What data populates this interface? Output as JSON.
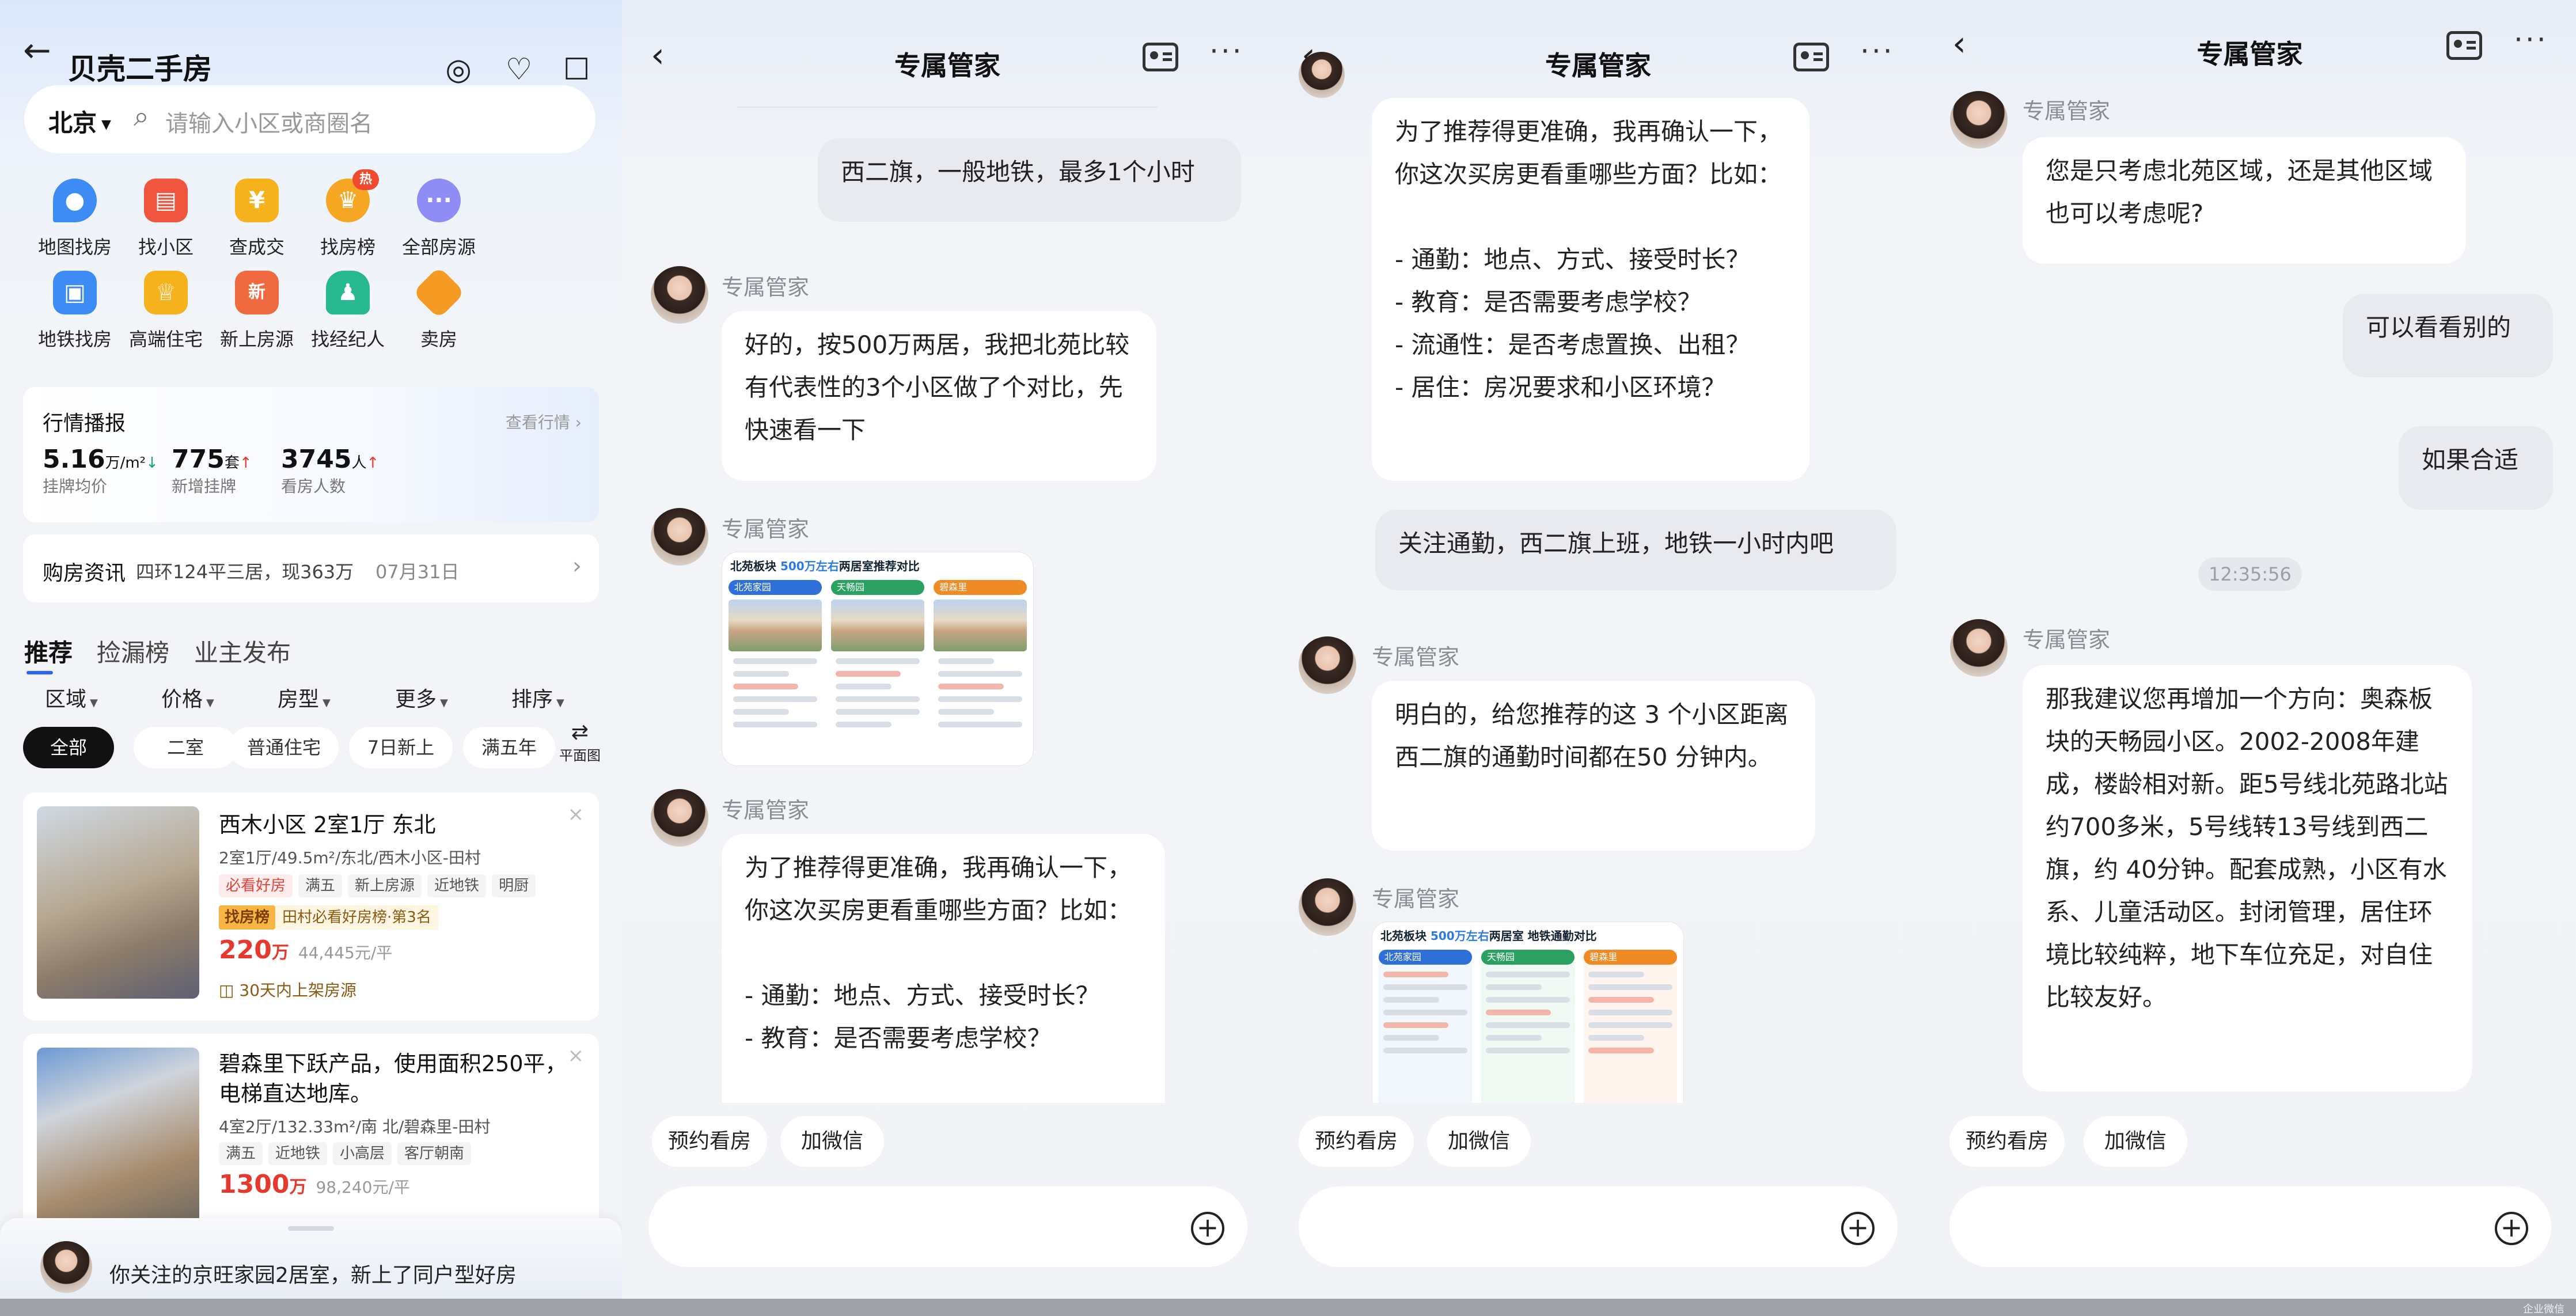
{
  "home": {
    "title": "贝壳二手房",
    "search": {
      "city": "北京",
      "placeholder": "请输入小区或商圈名"
    },
    "grid": [
      {
        "label": "地图找房",
        "icon": "map-pin-icon",
        "color": "#3d8bf5"
      },
      {
        "label": "找小区",
        "icon": "building-icon",
        "color": "#f0563f"
      },
      {
        "label": "查成交",
        "icon": "yen-icon",
        "color": "#f5b21c"
      },
      {
        "label": "找房榜",
        "icon": "crown-icon",
        "color": "#f5a623",
        "badge": "热"
      },
      {
        "label": "全部房源",
        "icon": "dots-icon",
        "color": "#8f8cf5"
      },
      {
        "label": "地铁找房",
        "icon": "subway-icon",
        "color": "#3d8bf5"
      },
      {
        "label": "高端住宅",
        "icon": "crown-icon",
        "color": "#f5b21c"
      },
      {
        "label": "新上房源",
        "icon": "new-icon",
        "color": "#f06a3f"
      },
      {
        "label": "找经纪人",
        "icon": "agent-icon",
        "color": "#28b990"
      },
      {
        "label": "卖房",
        "icon": "tag-icon",
        "color": "#f59a23"
      }
    ],
    "market": {
      "title": "行情播报",
      "link": "查看行情",
      "stats": [
        {
          "value": "5.16",
          "unit": "万/m²",
          "label": "挂牌均价",
          "trend": "down"
        },
        {
          "value": "775",
          "unit": "套",
          "label": "新增挂牌",
          "trend": "up"
        },
        {
          "value": "3745",
          "unit": "人",
          "label": "看房人数",
          "trend": "up"
        }
      ]
    },
    "news": {
      "title": "购房资讯",
      "text": "四环124平三居，现363万",
      "date": "07月31日"
    },
    "tabs": [
      "推荐",
      "捡漏榜",
      "业主发布"
    ],
    "filters": [
      "区域",
      "价格",
      "房型",
      "更多",
      "排序"
    ],
    "chips": [
      "全部",
      "二室",
      "普通住宅",
      "7日新上",
      "满五年"
    ],
    "plan_label": "平面图",
    "listings": [
      {
        "title": "西木小区 2室1厅 东北",
        "info": "2室1厅/49.5m²/东北/西木小区-田村",
        "tags": [
          "必看好房",
          "满五",
          "新上房源",
          "近地铁",
          "明厨"
        ],
        "rank_badge": "找房榜",
        "rank_text": "田村必看好房榜·第3名",
        "price": "220",
        "price_unit": "万",
        "unit_price": "44,445元/平",
        "note": "30天内上架房源"
      },
      {
        "title": "碧森里下跃产品，使用面积250平，电梯直达地库。",
        "info": "4室2厅/132.33m²/南 北/碧森里-田村",
        "tags": [
          "满五",
          "近地铁",
          "小高层",
          "客厅朝南"
        ],
        "price": "1300",
        "price_unit": "万",
        "unit_price": "98,240元/平"
      }
    ],
    "notify": "你关注的京旺家园2居室，新上了同户型好房"
  },
  "chat": {
    "title": "专属管家",
    "sender": "专属管家",
    "quick": [
      "预约看房",
      "加微信"
    ],
    "panel2": {
      "user1": "西二旗，一般地铁，最多1个小时",
      "bot1": "好的，按500万两居，我把北苑比较有代表性的3个小区做了个对比，先快速看一下",
      "img": {
        "title_pre": "北苑板块 ",
        "title_hl": "500万左右",
        "title_post": "两居室推荐对比",
        "cols": [
          {
            "name": "北苑家园",
            "color": "#2f6fd8"
          },
          {
            "name": "天畅园",
            "color": "#2aa160"
          },
          {
            "name": "碧森里",
            "color": "#f08a24"
          }
        ]
      },
      "bot2": "为了推荐得更准确，我再确认一下，你这次买房更看重哪些方面？比如：\n\n- 通勤：地点、方式、接受时长？\n- 教育：是否需要考虑学校？"
    },
    "panel3": {
      "bot1": "为了推荐得更准确，我再确认一下，你这次买房更看重哪些方面？比如：\n\n- 通勤：地点、方式、接受时长？\n- 教育：是否需要考虑学校？\n- 流通性：是否考虑置换、出租？\n- 居住：房况要求和小区环境？",
      "user1": "关注通勤，西二旗上班，地铁一小时内吧",
      "bot2": "明白的，给您推荐的这 3 个小区距离西二旗的通勤时间都在50 分钟内。",
      "img": {
        "title_pre": "北苑板块 ",
        "title_hl": "500万左右",
        "title_post": "两居室 地铁通勤对比",
        "cols": [
          {
            "name": "北苑家园",
            "color": "#2f6fd8"
          },
          {
            "name": "天畅园",
            "color": "#2aa160"
          },
          {
            "name": "碧森里",
            "color": "#f08a24"
          }
        ]
      }
    },
    "panel4": {
      "bot1": "您是只考虑北苑区域，还是其他区域也可以考虑呢?",
      "user1": "可以看看别的",
      "user2": "如果合适",
      "time": "12:35:56",
      "bot2": "那我建议您再增加一个方向：奥森板块的天畅园小区。2002-2008年建成，楼龄相对新。距5号线北苑路北站约700多米，5号线转13号线到西二旗，约 40分钟。配套成熟，小区有水系、儿童活动区。封闭管理，居住环境比较纯粹，地下车位充足，对自住比较友好。"
    }
  },
  "watermark": "企业微信"
}
